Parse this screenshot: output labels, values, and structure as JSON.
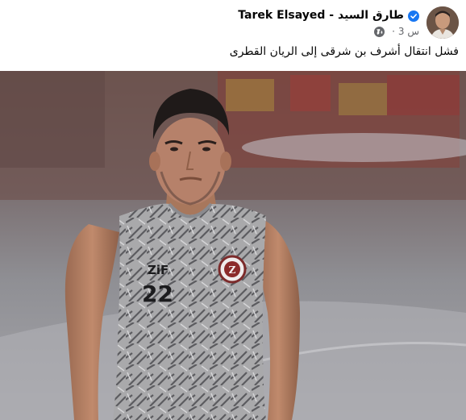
{
  "post": {
    "author": "Tarek Elsayed - طارق السيد",
    "verified_icon": "verified-badge-icon",
    "timestamp": "3 س",
    "separator": "·",
    "audience_icon": "globe-icon",
    "text": "فشل انتقال أشرف بن شرقى إلى الريان القطرى"
  },
  "photo": {
    "jersey_number": "22",
    "jersey_initials": "ZiF",
    "club_logo_letter": "Z"
  },
  "colors": {
    "author_text": "#050505",
    "meta_text": "#65676b",
    "verified_blue": "#1877f2"
  }
}
